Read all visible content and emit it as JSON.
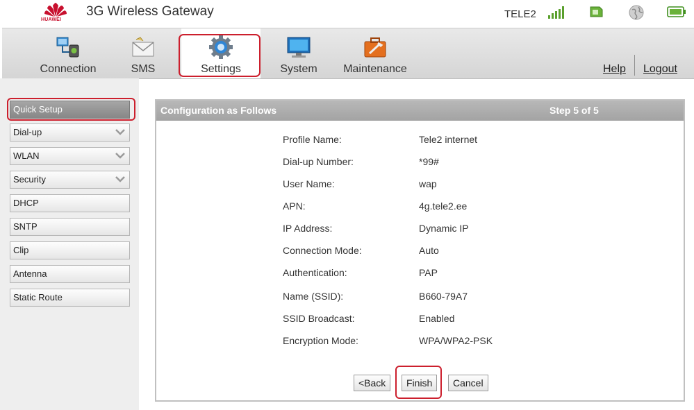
{
  "header": {
    "brand": "HUAWEI",
    "title": "3G Wireless Gateway",
    "operator": "TELE2",
    "status_icons": [
      "signal-strength-icon",
      "sim-card-icon",
      "globe-icon",
      "battery-icon"
    ]
  },
  "nav": {
    "items": [
      {
        "label": "Connection",
        "icon": "connection-icon"
      },
      {
        "label": "SMS",
        "icon": "sms-envelope-icon"
      },
      {
        "label": "Settings",
        "icon": "settings-gear-icon",
        "active": true
      },
      {
        "label": "System",
        "icon": "system-monitor-icon"
      },
      {
        "label": "Maintenance",
        "icon": "maintenance-toolbox-icon"
      }
    ],
    "help": "Help",
    "logout": "Logout"
  },
  "sidebar": {
    "items": [
      {
        "label": "Quick Setup",
        "active": true,
        "expandable": false
      },
      {
        "label": "Dial-up",
        "expandable": true
      },
      {
        "label": "WLAN",
        "expandable": true
      },
      {
        "label": "Security",
        "expandable": true
      },
      {
        "label": "DHCP",
        "expandable": false
      },
      {
        "label": "SNTP",
        "expandable": false
      },
      {
        "label": "Clip",
        "expandable": false
      },
      {
        "label": "Antenna",
        "expandable": false
      },
      {
        "label": "Static Route",
        "expandable": false
      }
    ]
  },
  "panel": {
    "title": "Configuration as Follows",
    "step": "Step 5 of 5",
    "fields": [
      {
        "label": "Profile Name:",
        "value": "Tele2 internet"
      },
      {
        "label": "Dial-up Number:",
        "value": "*99#"
      },
      {
        "label": "User Name:",
        "value": "wap"
      },
      {
        "label": "APN:",
        "value": "4g.tele2.ee"
      },
      {
        "label": "IP Address:",
        "value": "Dynamic IP"
      },
      {
        "label": "Connection Mode:",
        "value": "Auto"
      },
      {
        "label": "Authentication:",
        "value": "PAP"
      },
      {
        "label": "Name (SSID):",
        "value": "B660-79A7"
      },
      {
        "label": "SSID Broadcast:",
        "value": "Enabled"
      },
      {
        "label": "Encryption Mode:",
        "value": "WPA/WPA2-PSK"
      }
    ],
    "buttons": {
      "back": "<Back",
      "finish": "Finish",
      "cancel": "Cancel"
    }
  },
  "colors": {
    "highlight": "#cc1f2d",
    "brand": "#c8102e",
    "signal": "#5aa02c",
    "panel_header": "#adadad"
  }
}
